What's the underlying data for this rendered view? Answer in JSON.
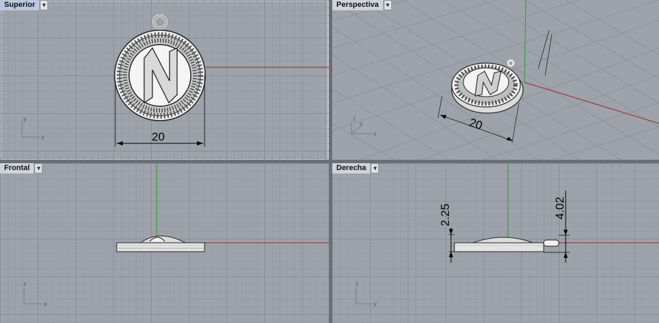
{
  "viewports": [
    {
      "key": "top",
      "label": "Superior",
      "active": true
    },
    {
      "key": "perspective",
      "label": "Perspectiva",
      "active": false
    },
    {
      "key": "front",
      "label": "Frontal",
      "active": false
    },
    {
      "key": "right",
      "label": "Derecha",
      "active": false
    }
  ],
  "dimensions": {
    "top_width": "20",
    "perspective_width": "20",
    "right_height_left": "2.25",
    "right_height_right": "4.02"
  },
  "axes": {
    "x": "x",
    "y": "y",
    "z": "z"
  },
  "pendant_glyph": "N",
  "colors": {
    "viewport_bg": "#9ea2aa",
    "grid_minor": "#979ba3",
    "grid_major": "#8a8e96",
    "axis_red": "#a3242b",
    "axis_green": "#2f9a2f",
    "active_tab": "#b9c8e0"
  }
}
